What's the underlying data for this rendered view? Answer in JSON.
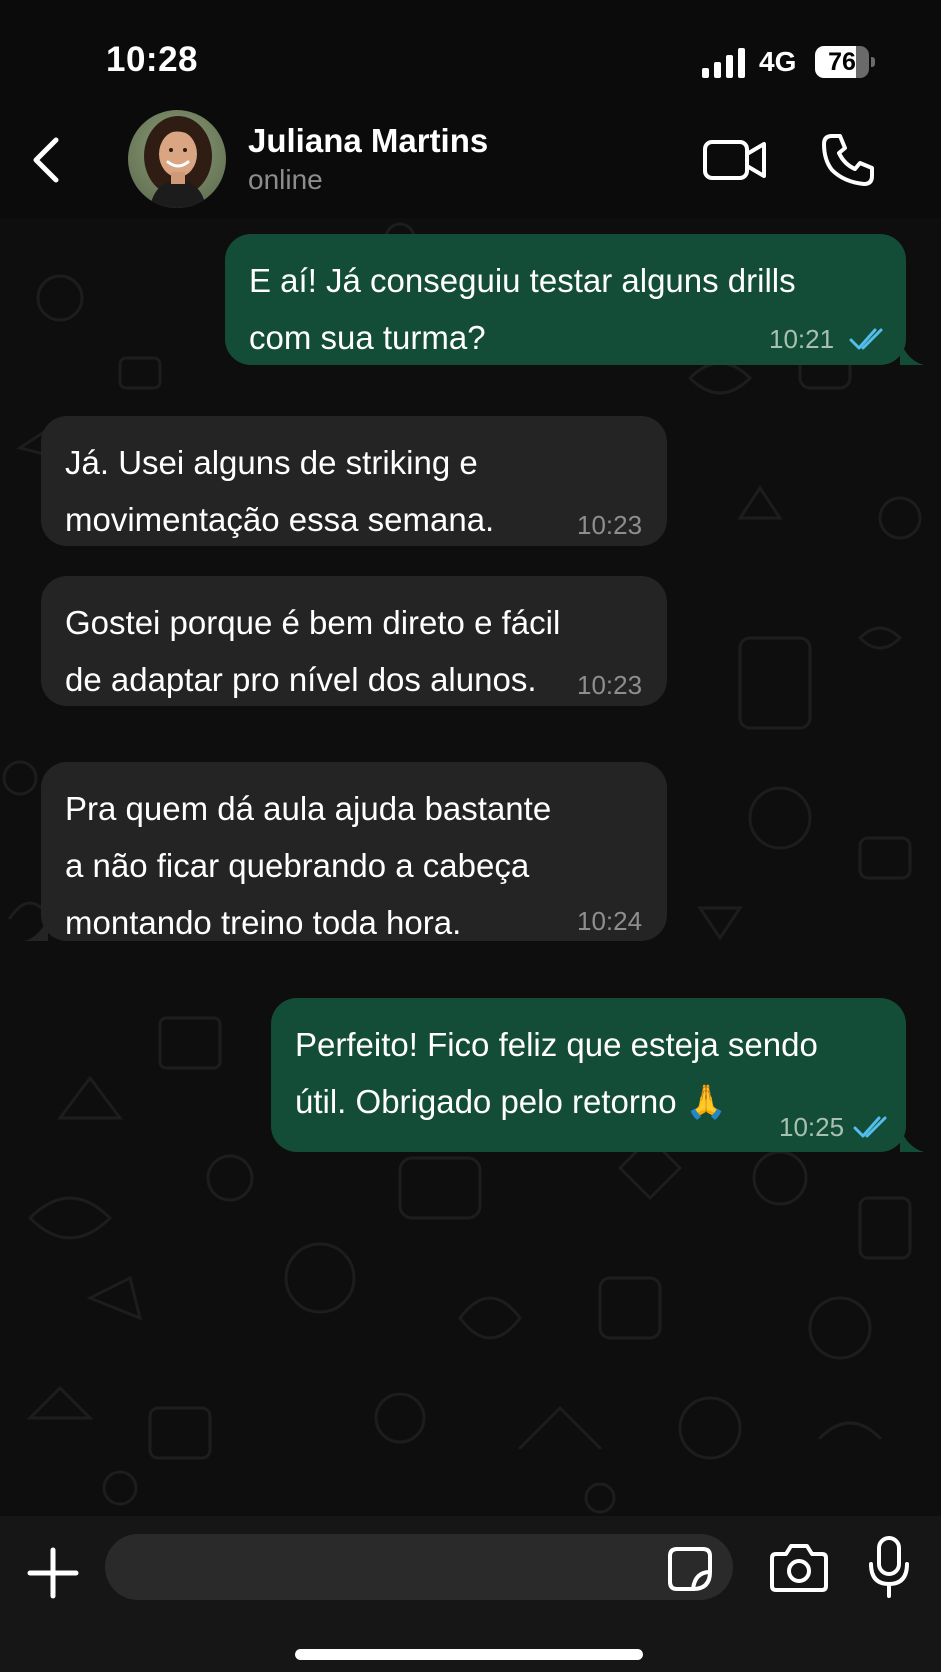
{
  "status_bar": {
    "time": "10:28",
    "network": "4G",
    "battery": "76"
  },
  "header": {
    "contact_name": "Juliana Martins",
    "contact_status": "online"
  },
  "messages": [
    {
      "direction": "outgoing",
      "text": "E aí! Já conseguiu testar alguns drills\ncom sua turma?",
      "time": "10:21",
      "read": true
    },
    {
      "direction": "incoming",
      "text": "Já. Usei alguns de striking e\nmovimentação essa semana.",
      "time": "10:23"
    },
    {
      "direction": "incoming",
      "text": "Gostei porque é bem direto e fácil\nde adaptar pro nível dos alunos.",
      "time": "10:23"
    },
    {
      "direction": "incoming",
      "text": "Pra quem dá aula ajuda bastante\na não ficar quebrando a cabeça\nmontando treino toda hora.",
      "time": "10:24"
    },
    {
      "direction": "outgoing",
      "text": "Perfeito! Fico feliz que esteja sendo\nútil. Obrigado pelo retorno 🙏",
      "time": "10:25",
      "read": true
    }
  ],
  "input": {
    "placeholder": ""
  },
  "colors": {
    "outgoing_bubble": "#144d37",
    "incoming_bubble": "#242424",
    "read_ticks": "#53bdeb",
    "background": "#0b0b0b"
  }
}
